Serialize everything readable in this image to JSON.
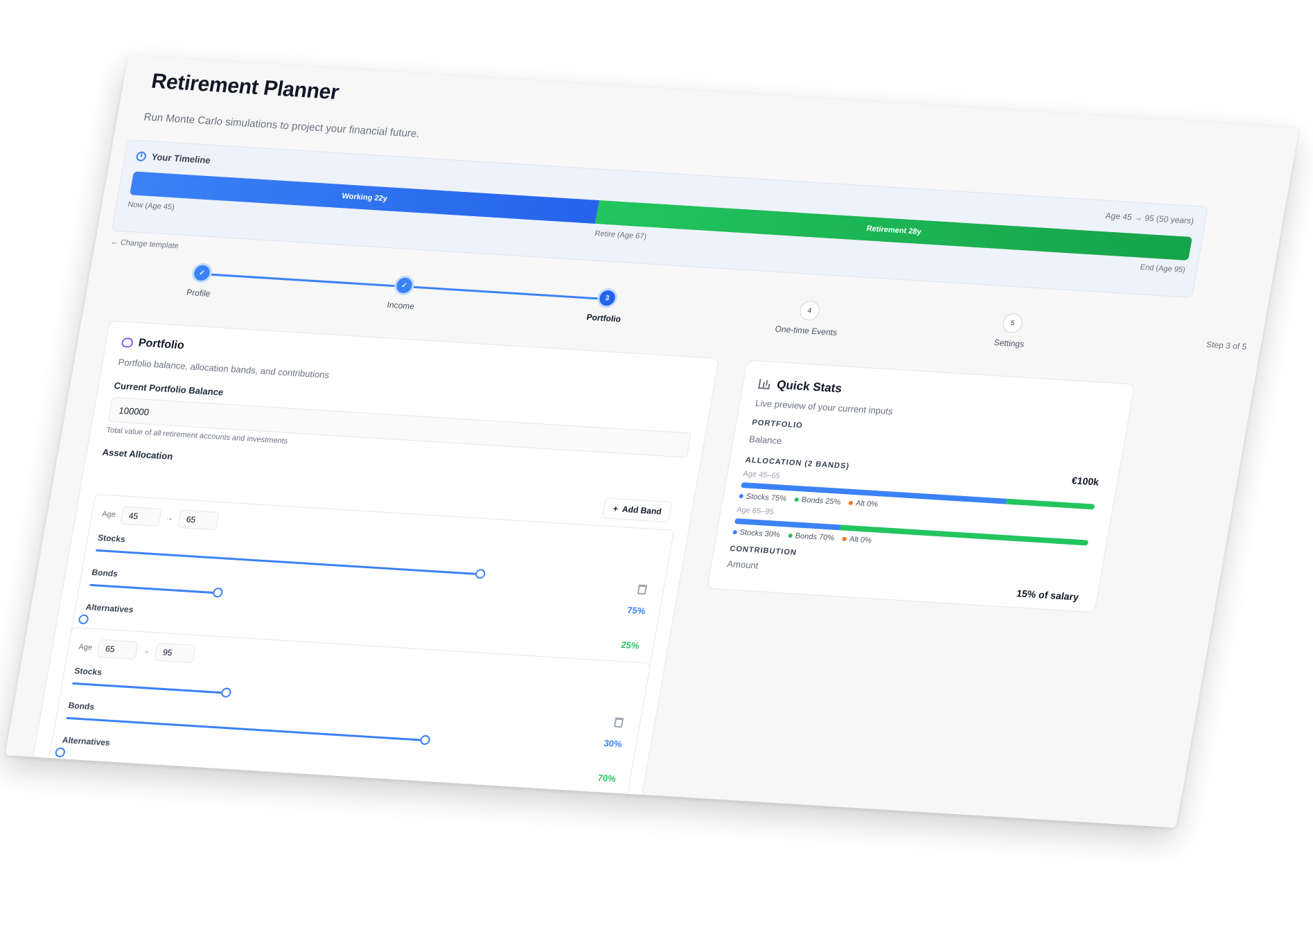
{
  "header": {
    "title": "Retirement Planner",
    "subtitle": "Run Monte Carlo simulations to project your financial future."
  },
  "timeline": {
    "title": "Your Timeline",
    "working_label": "Working 22y",
    "retirement_label": "Retirement 28y",
    "now_label": "Now (Age 45)",
    "retire_label": "Retire (Age 67)",
    "end_label": "End (Age 95)",
    "span_label": "Age 45 → 95 (50 years)",
    "marker_icon": "piggy-bank-icon"
  },
  "nav": {
    "change_template": "← Change template"
  },
  "stepper": {
    "step_count": "Step 3 of 5",
    "steps": [
      {
        "label": "Profile",
        "number": "✓",
        "state": "done"
      },
      {
        "label": "Income",
        "number": "✓",
        "state": "done"
      },
      {
        "label": "Portfolio",
        "number": "3",
        "state": "current"
      },
      {
        "label": "One-time Events",
        "number": "4",
        "state": "todo"
      },
      {
        "label": "Settings",
        "number": "5",
        "state": "todo"
      }
    ]
  },
  "portfolio": {
    "title": "Portfolio",
    "subtitle": "Portfolio balance, allocation bands, and contributions",
    "balance_label": "Current Portfolio Balance",
    "balance_value": "100000",
    "balance_help": "Total value of all retirement accounts and investments",
    "allocation_title": "Asset Allocation",
    "add_band_label": "Add Band",
    "age_label": "Age",
    "arrow": "→",
    "bands": [
      {
        "age_from": "45",
        "age_to": "65",
        "stocks_label": "Stocks",
        "bonds_label": "Bonds",
        "alt_label": "Alternatives",
        "stocks_pct": "75%",
        "bonds_pct": "25%",
        "alt_pct": "0%",
        "stocks": 75,
        "bonds": 25,
        "alt": 0
      },
      {
        "age_from": "65",
        "age_to": "95",
        "stocks_label": "Stocks",
        "bonds_label": "Bonds",
        "alt_label": "Alternatives",
        "stocks_pct": "30%",
        "bonds_pct": "70%",
        "alt_pct": "0%",
        "stocks": 30,
        "bonds": 70,
        "alt": 0
      }
    ]
  },
  "quick_stats": {
    "title": "Quick Stats",
    "subtitle": "Live preview of your current inputs",
    "portfolio_section": "Portfolio",
    "balance_label": "Balance",
    "balance_value": "€100k",
    "allocation_section": "Allocation (2 bands)",
    "bands": [
      {
        "label": "Age 45–65",
        "stocks": 75,
        "bonds": 25,
        "alt": 0,
        "legend_stocks": "Stocks 75%",
        "legend_bonds": "Bonds 25%",
        "legend_alt": "Alt 0%"
      },
      {
        "label": "Age 65–95",
        "stocks": 30,
        "bonds": 70,
        "alt": 0,
        "legend_stocks": "Stocks 30%",
        "legend_bonds": "Bonds 70%",
        "legend_alt": "Alt 0%"
      }
    ],
    "contribution_section": "Contribution",
    "amount_label": "Amount",
    "amount_value": "15% of salary"
  },
  "colors": {
    "stocks": "#3b82f6",
    "bonds": "#22c55e",
    "alt": "#f97316"
  }
}
